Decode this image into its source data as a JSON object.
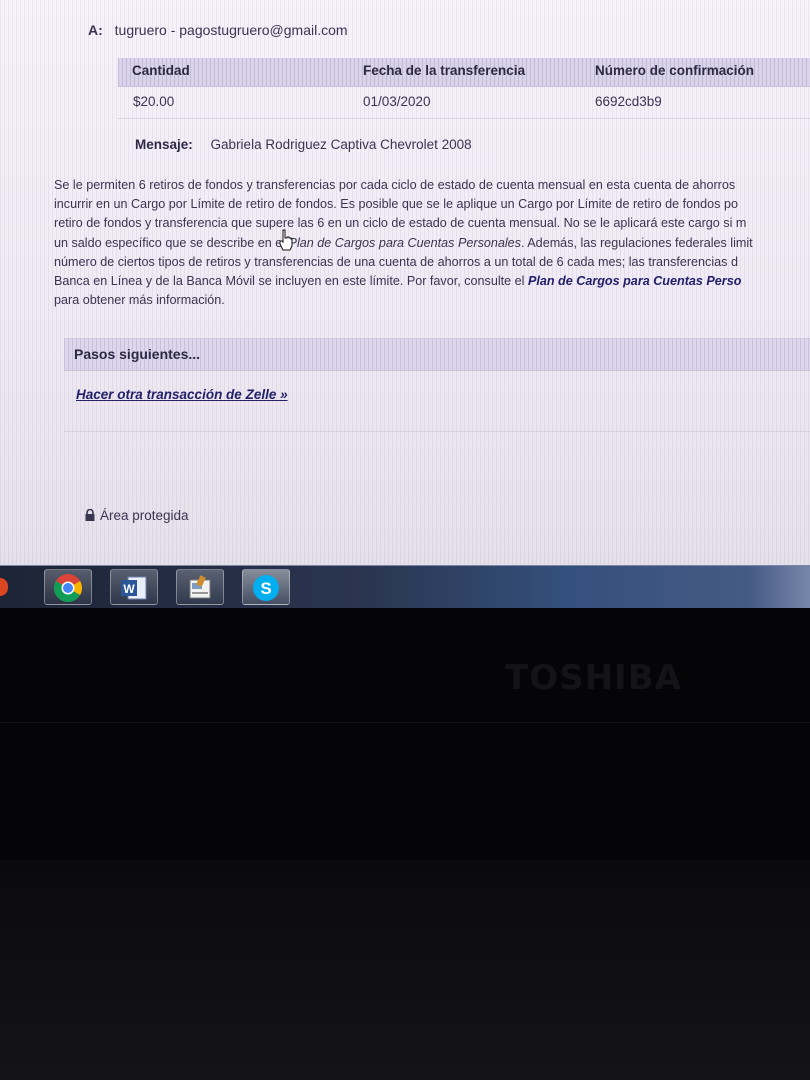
{
  "recipient": {
    "label": "A:",
    "value": "tugruero - pagostugruero@gmail.com"
  },
  "transfer_table": {
    "headers": [
      "Cantidad",
      "Fecha de la transferencia",
      "Número de confirmación"
    ],
    "row": {
      "amount": "$20.00",
      "date": "01/03/2020",
      "confirmation": "6692cd3b9"
    }
  },
  "message": {
    "label": "Mensaje:",
    "value": "Gabriela Rodriguez Captiva Chevrolet 2008"
  },
  "notice": {
    "line1": "Se le permiten 6 retiros de fondos y transferencias por cada ciclo de estado de cuenta mensual en esta cuenta de ahorros",
    "line2": "incurrir en un Cargo por Límite de retiro de fondos. Es posible que se le aplique un Cargo por Límite de retiro de fondos po",
    "line3": "retiro de fondos y transferencia que supere las 6 en un ciclo de estado de cuenta mensual. No se le aplicará este cargo si m",
    "line4_a": "un saldo específico que se describe en el ",
    "line4_em": "Plan de Cargos para Cuentas Personales",
    "line4_b": ". Además, las regulaciones federales limit",
    "line5": "número de ciertos tipos de retiros y transferencias de una cuenta de ahorros a un total de 6 cada mes; las transferencias d",
    "line6_a": "Banca en Línea y de la Banca Móvil se incluyen en este límite. Por favor, consulte el ",
    "line6_link": "Plan de Cargos para Cuentas Perso",
    "line7": "para obtener más información."
  },
  "next_steps": {
    "title": "Pasos siguientes...",
    "link": "Hacer otra transacción de Zelle »"
  },
  "secure_area": "Área protegida",
  "taskbar": {
    "icons": [
      "chrome-icon",
      "word-icon",
      "document-viewer-icon",
      "skype-icon"
    ]
  },
  "laptop_brand": "TOSHIBA"
}
